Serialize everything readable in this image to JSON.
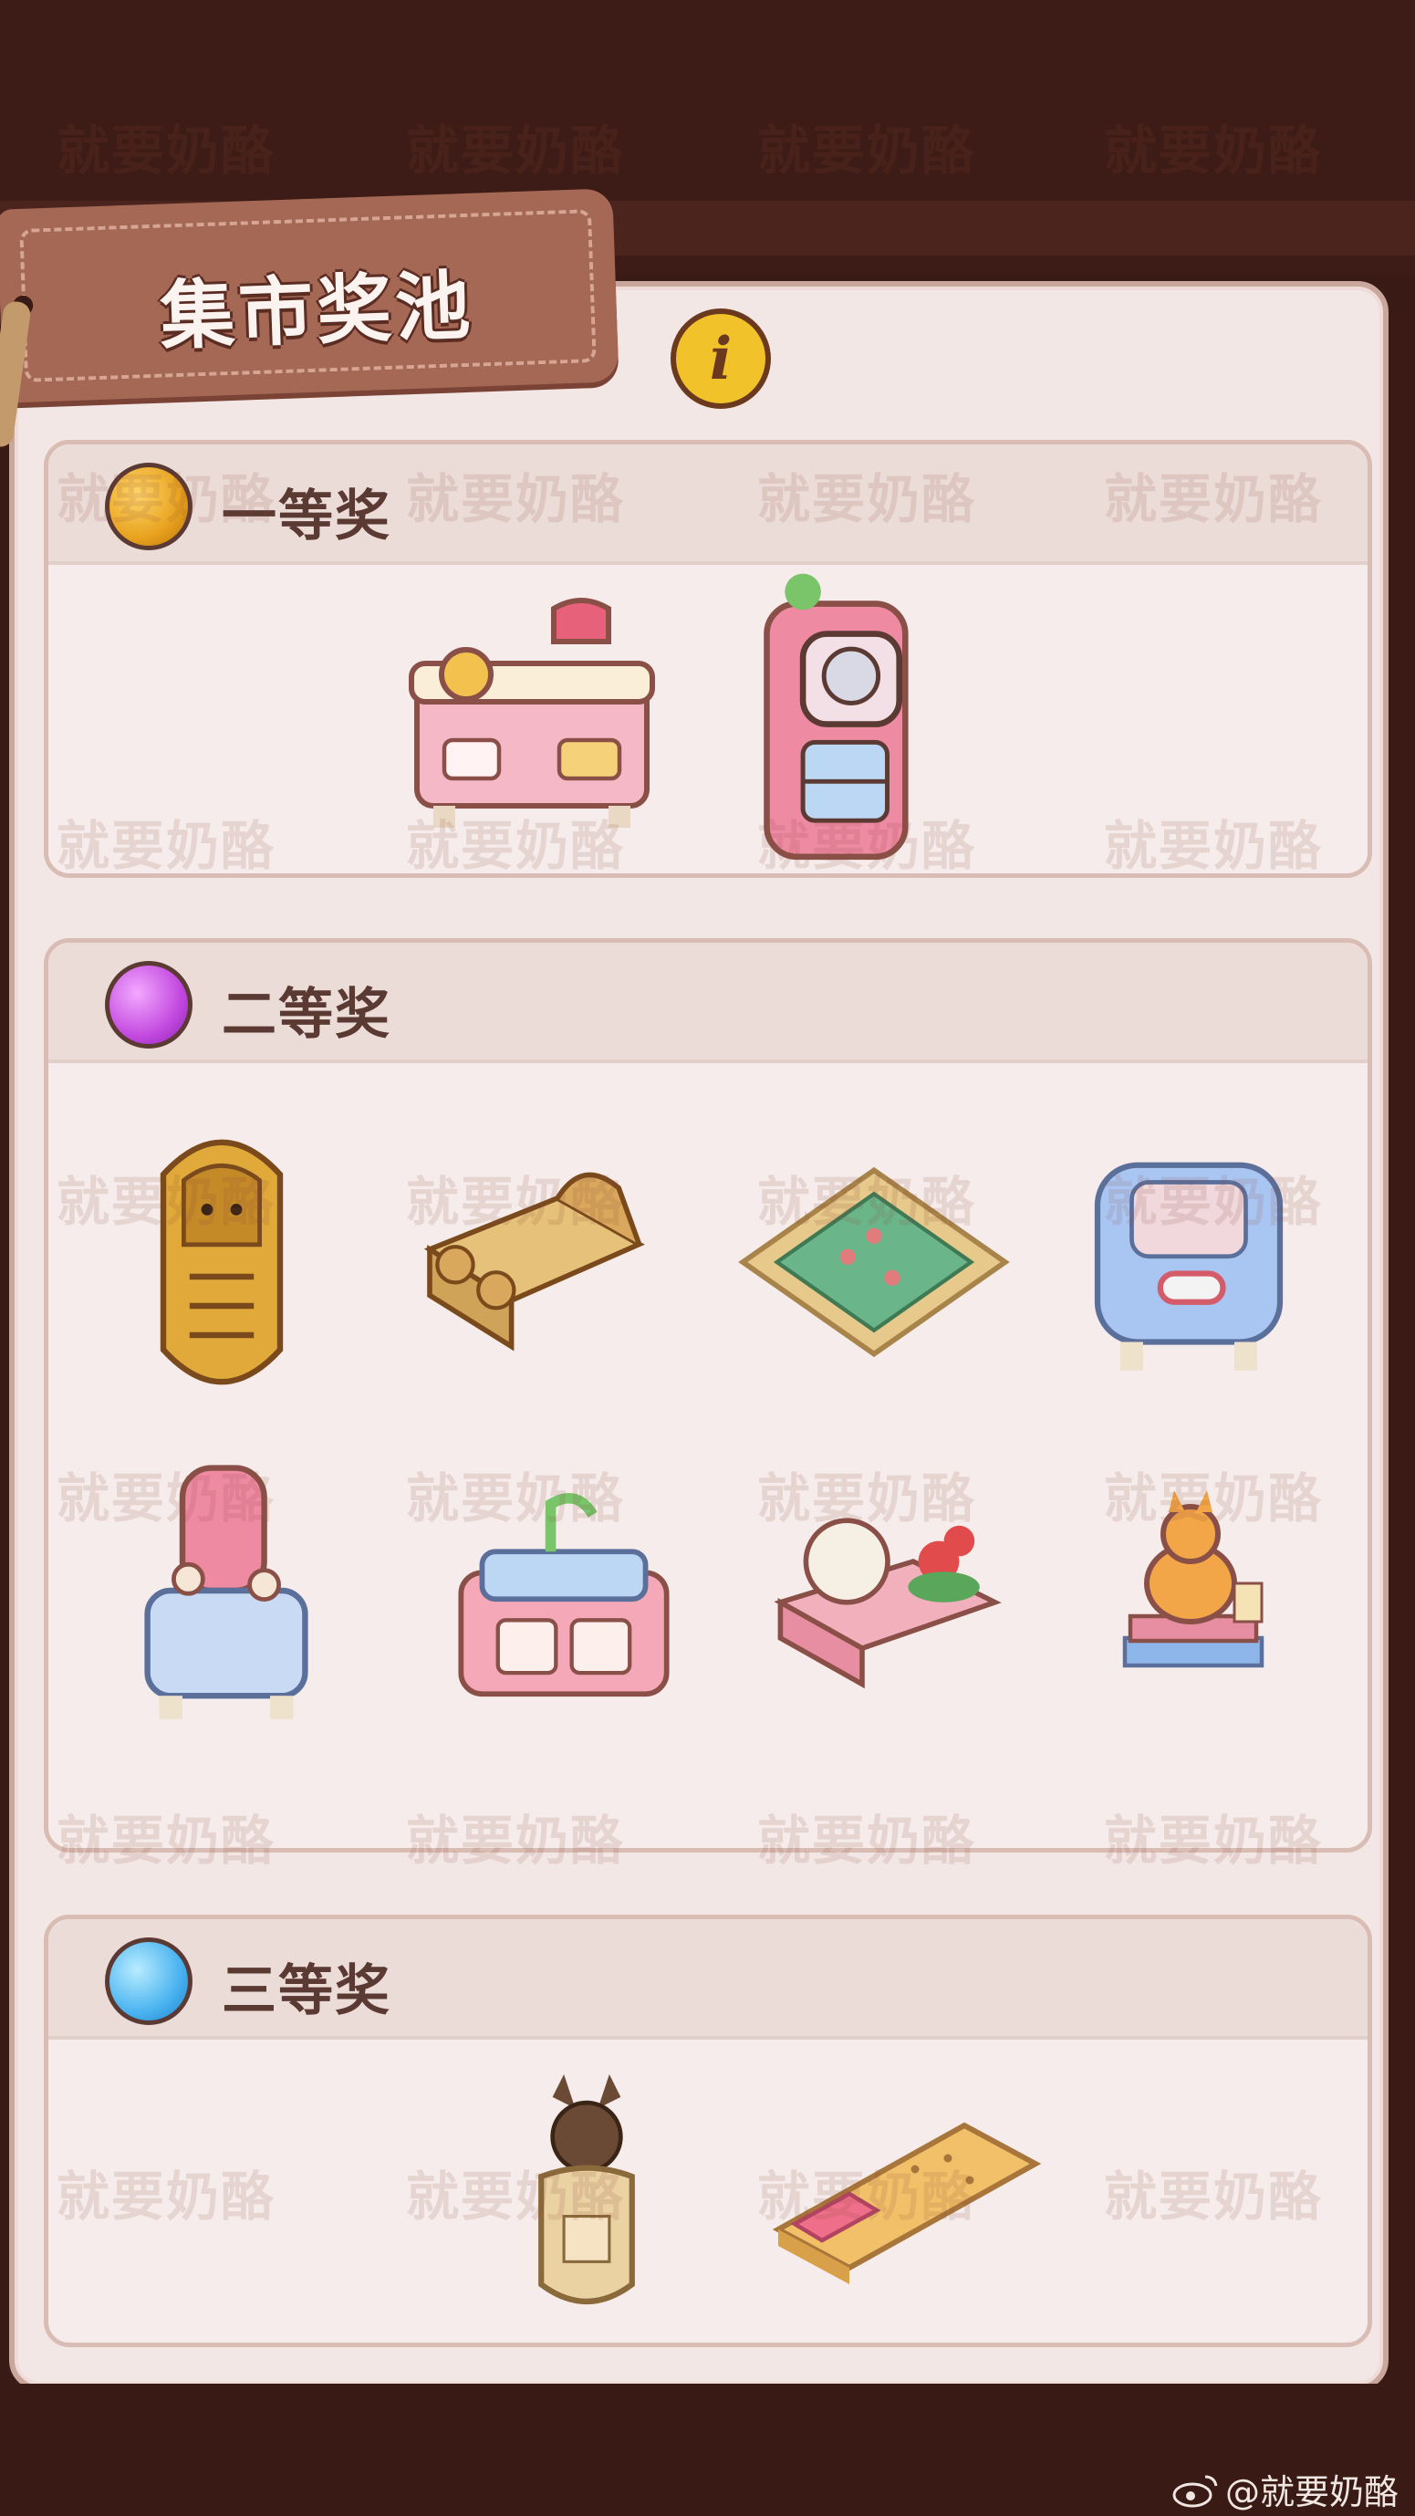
{
  "header": {
    "title": "集市奖池",
    "info_icon": "info-icon"
  },
  "sections": [
    {
      "title": "一等奖",
      "orb_color": "#e8a21e",
      "items": [
        "kitchen-counter-icon",
        "pink-vending-fridge-icon"
      ]
    },
    {
      "title": "二等奖",
      "orb_color": "#c34ae0",
      "items": [
        "pharaoh-sarcophagus-icon",
        "golden-cat-bed-icon",
        "green-carpet-icon",
        "blue-cabinet-icon",
        "pink-bathroom-stand-icon",
        "pink-sink-counter-icon",
        "plate-flower-shelf-icon",
        "cat-on-books-icon"
      ]
    },
    {
      "title": "三等奖",
      "orb_color": "#4ab3f0",
      "items": [
        "anubis-jar-icon",
        "biscuit-rug-icon"
      ]
    }
  ],
  "watermark": "就要奶酪",
  "credit": "@就要奶酪",
  "colors": {
    "panel": "#f3e7e5",
    "frame": "#3a1a15",
    "tag": "#a56855",
    "info": "#f2c22a"
  }
}
